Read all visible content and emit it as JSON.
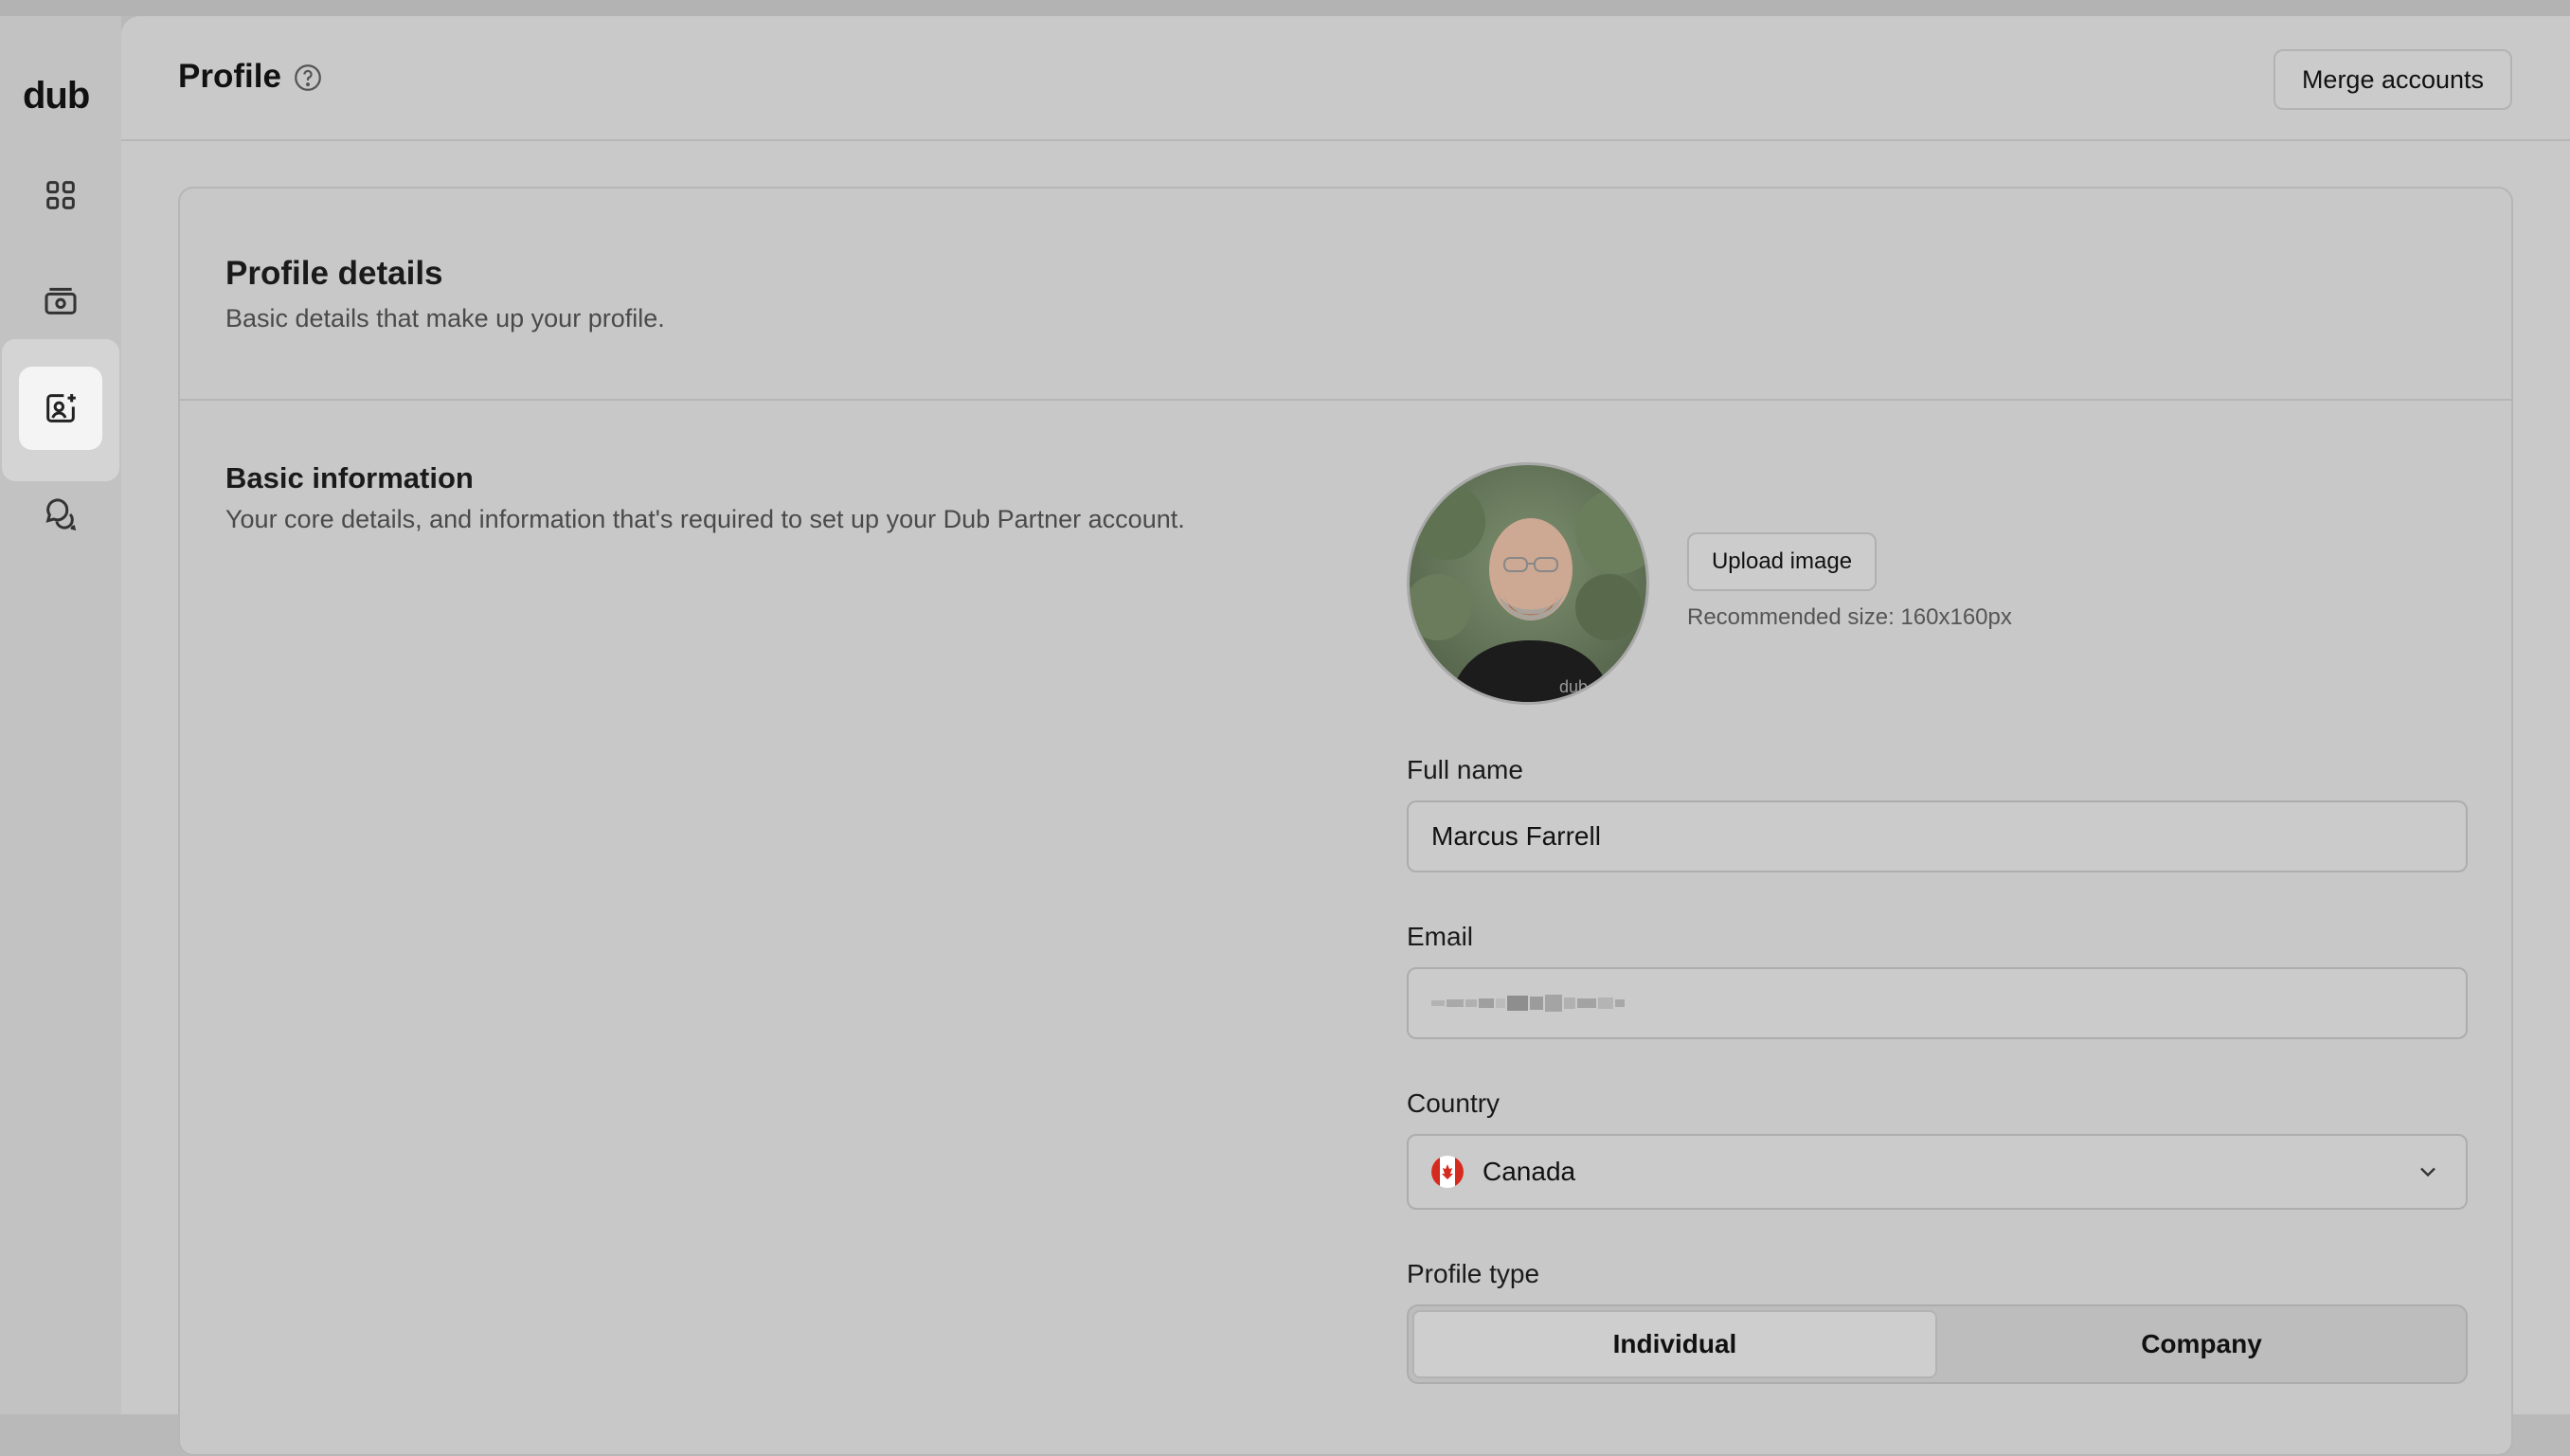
{
  "app": {
    "logo_text": "dub"
  },
  "sidebar": {
    "items": [
      {
        "name": "dashboard",
        "icon": "grid-icon"
      },
      {
        "name": "payouts",
        "icon": "cash-icon"
      },
      {
        "name": "profile",
        "icon": "profile-sparkle-icon",
        "active": true
      },
      {
        "name": "messages",
        "icon": "chat-bubbles-icon"
      }
    ]
  },
  "header": {
    "title": "Profile",
    "help_icon": "question-circle-icon",
    "merge_label": "Merge accounts"
  },
  "profile_details": {
    "title": "Profile details",
    "subtitle": "Basic details that make up your profile."
  },
  "basic_info": {
    "title": "Basic information",
    "subtitle": "Your core details, and information that's required to set up your Dub Partner account.",
    "upload_label": "Upload image",
    "recommended_size": "Recommended size: 160x160px",
    "full_name_label": "Full name",
    "full_name_value": "Marcus Farrell",
    "email_label": "Email",
    "country_label": "Country",
    "country_value": "Canada",
    "country_flag_icon": "canada-flag-icon",
    "profile_type_label": "Profile type",
    "profile_type_options": [
      "Individual",
      "Company"
    ],
    "profile_type_selected": "Individual"
  },
  "colors": {
    "background": "#c9c9c9",
    "rail": "#c2c2c2",
    "active_rail_item": "#f4f4f4",
    "canada_red": "#d52b1e"
  }
}
